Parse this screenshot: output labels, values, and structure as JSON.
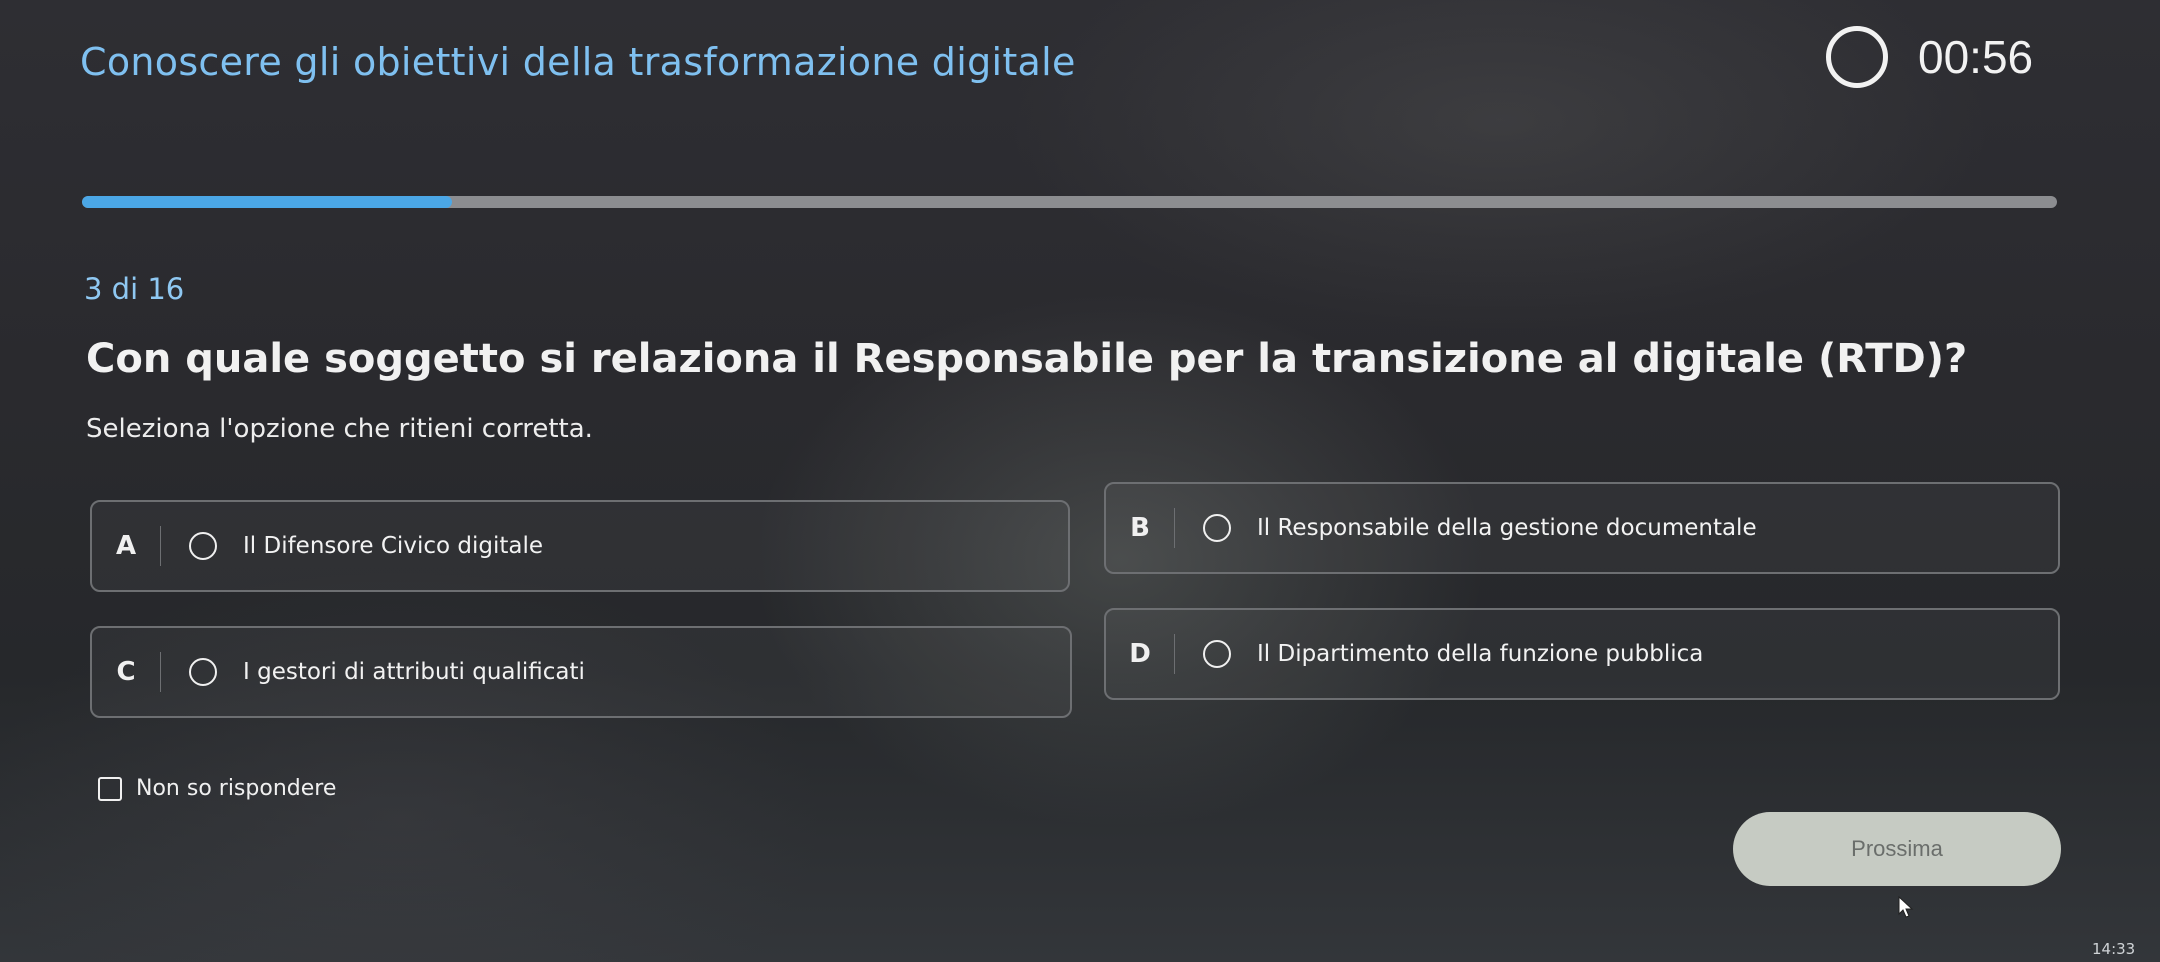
{
  "header": {
    "title": "Conoscere gli obiettivi della trasformazione digitale",
    "timer": "00:56",
    "timer_icon": "timer-ring-icon"
  },
  "progress": {
    "fraction": 0.1875
  },
  "question": {
    "counter": "3 di 16",
    "text": "Con quale soggetto si relaziona il Responsabile per la transizione al digitale (RTD)?",
    "hint": "Seleziona l'opzione che ritieni corretta.",
    "options": [
      {
        "letter": "A",
        "label": "Il Difensore Civico digitale"
      },
      {
        "letter": "B",
        "label": "Il Responsabile della gestione documentale"
      },
      {
        "letter": "C",
        "label": "I gestori di attributi qualificati"
      },
      {
        "letter": "D",
        "label": "Il Dipartimento della funzione pubblica"
      }
    ],
    "dont_know_label": "Non so rispondere"
  },
  "footer": {
    "next_label": "Prossima",
    "clock": "14:33"
  },
  "colors": {
    "title": "#7fc0f0",
    "progress": "#4ba7e6",
    "button": "#c6cbc3"
  }
}
